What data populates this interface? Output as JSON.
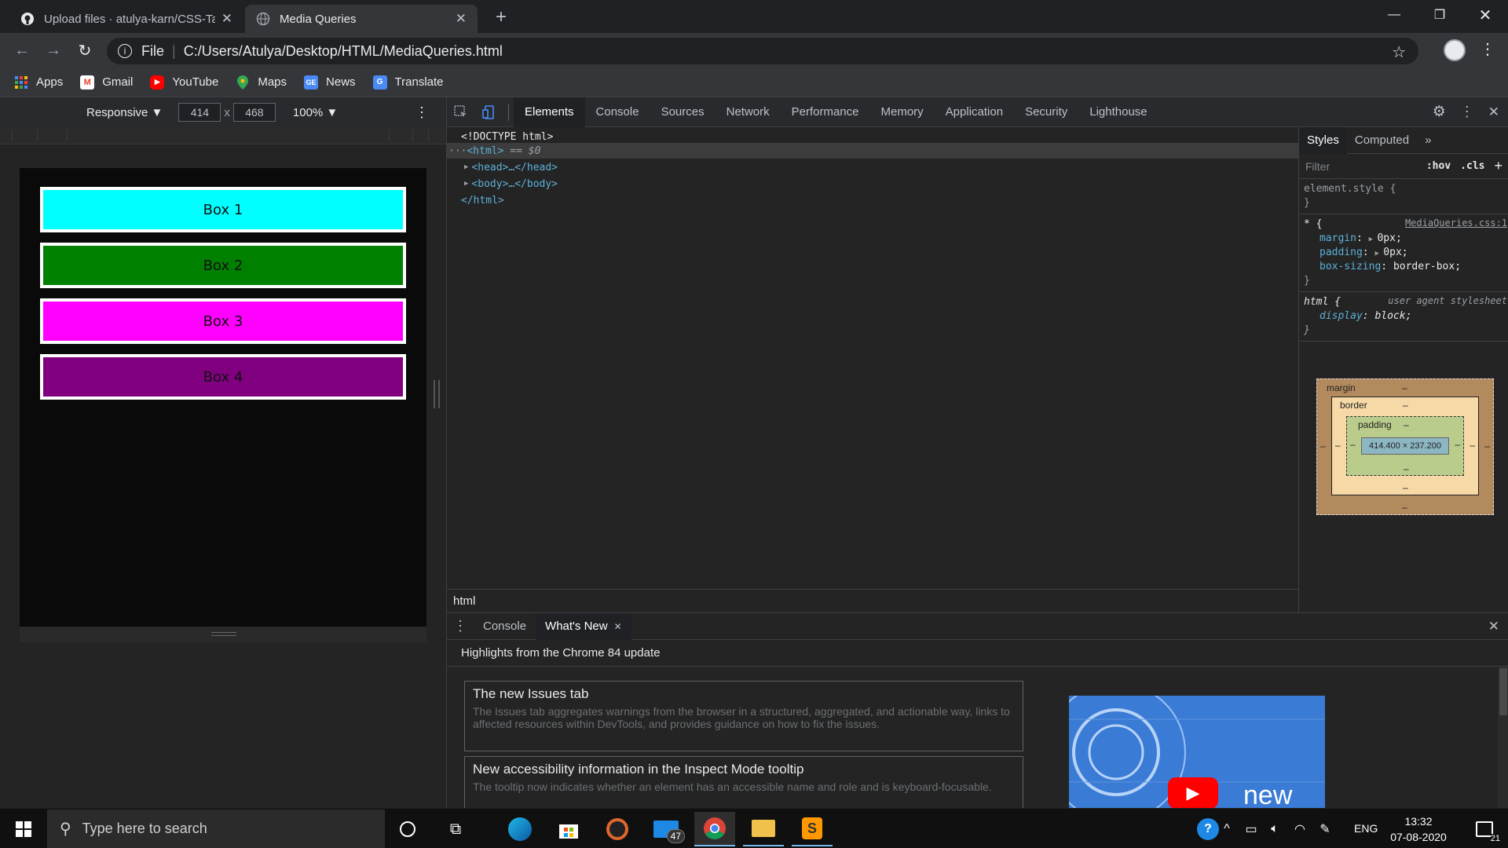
{
  "browser": {
    "tabs": [
      {
        "title": "Upload files · atulya-karn/CSS-Ta",
        "icon": "github-icon"
      },
      {
        "title": "Media Queries",
        "icon": "globe-icon"
      }
    ],
    "new_tab": "+",
    "url_scheme": "File",
    "url": "C:/Users/Atulya/Desktop/HTML/MediaQueries.html"
  },
  "bookmarks": [
    {
      "label": "Apps",
      "icon": "apps-grid-icon"
    },
    {
      "label": "Gmail",
      "icon": "gmail-icon"
    },
    {
      "label": "YouTube",
      "icon": "youtube-icon"
    },
    {
      "label": "Maps",
      "icon": "maps-pin-icon"
    },
    {
      "label": "News",
      "icon": "news-icon"
    },
    {
      "label": "Translate",
      "icon": "translate-icon"
    }
  ],
  "device_toolbar": {
    "mode": "Responsive ▼",
    "width": "414",
    "times": "x",
    "height": "468",
    "zoom": "100% ▼"
  },
  "page_boxes": [
    {
      "label": "Box 1",
      "color": "#00ffff"
    },
    {
      "label": "Box 2",
      "color": "#008000"
    },
    {
      "label": "Box 3",
      "color": "#ff00ff"
    },
    {
      "label": "Box 4",
      "color": "#800080"
    }
  ],
  "devtools": {
    "tabs": [
      "Elements",
      "Console",
      "Sources",
      "Network",
      "Performance",
      "Memory",
      "Application",
      "Security",
      "Lighthouse"
    ],
    "active_tab": "Elements",
    "dom": {
      "doctype": "<!DOCTYPE html>",
      "html_open": "<html>",
      "selected_marker": " == $0",
      "head": "<head>…</head>",
      "body": "<body>…</body>",
      "html_close": "</html>"
    },
    "breadcrumb": "html",
    "styles": {
      "tabs": [
        "Styles",
        "Computed"
      ],
      "more": "»",
      "filter_placeholder": "Filter",
      "hov": ":hov",
      "cls": ".cls",
      "add": "+",
      "element_style": "element.style {",
      "close_brace": "}",
      "universal_selector": "* {",
      "universal_source": "MediaQueries.css:1",
      "universal_props": [
        {
          "name": "margin",
          "value": "0px;"
        },
        {
          "name": "padding",
          "value": "0px;"
        },
        {
          "name": "box-sizing",
          "value": "border-box;"
        }
      ],
      "html_selector": "html {",
      "html_source": "user agent stylesheet",
      "html_props": [
        {
          "name": "display",
          "value": "block;"
        }
      ]
    },
    "box_model": {
      "margin_label": "margin",
      "border_label": "border",
      "padding_label": "padding",
      "dash": "–",
      "content": "414.400 × 237.200"
    },
    "drawer": {
      "tabs": [
        "Console",
        "What's New"
      ],
      "active_tab": "What's New",
      "heading": "Highlights from the Chrome 84 update",
      "cards": [
        {
          "title": "The new Issues tab",
          "text": "The Issues tab aggregates warnings from the browser in a structured, aggregated, and actionable way, links to affected resources within DevTools, and provides guidance on how to fix the issues."
        },
        {
          "title": "New accessibility information in the Inspect Mode tooltip",
          "text": "The tooltip now indicates whether an element has an accessible name and role and is keyboard-focusable."
        }
      ],
      "video_text": "new"
    }
  },
  "taskbar": {
    "search_placeholder": "Type here to search",
    "mail_badge": "47",
    "language": "ENG",
    "time": "13:32",
    "date": "07-08-2020",
    "notification_count": "21"
  }
}
